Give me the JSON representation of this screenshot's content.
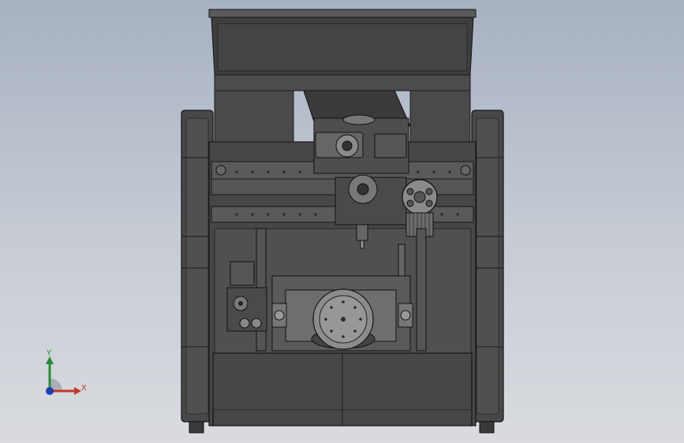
{
  "viewport": {
    "background_top": "#a7b1c2",
    "background_bottom": "#d9dbdf"
  },
  "model": {
    "description_icon": "cnc-machine-3d-model",
    "body_color": "#4a4a4a",
    "edge_color": "#1a1a1a",
    "part_color": "#5a5a5a",
    "light_part_color": "#8a8a8a"
  },
  "triad": {
    "x_label": "X",
    "y_label": "Y",
    "x_color": "#c0392b",
    "y_color": "#2a8a3a",
    "z_color": "#1f3fb0"
  }
}
